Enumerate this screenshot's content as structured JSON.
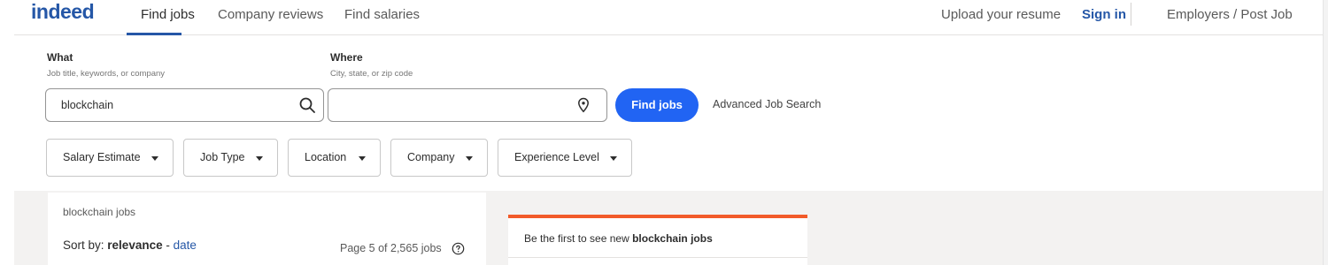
{
  "header": {
    "logo": "indeed",
    "nav": [
      "Find jobs",
      "Company reviews",
      "Find salaries"
    ],
    "upload_resume": "Upload your resume",
    "sign_in": "Sign in",
    "employers": "Employers / Post Job"
  },
  "search": {
    "what_label": "What",
    "what_hint": "Job title, keywords, or company",
    "what_value": "blockchain",
    "where_label": "Where",
    "where_hint": "City, state, or zip code",
    "where_value": "",
    "find_button": "Find jobs",
    "advanced_link": "Advanced Job Search"
  },
  "filters": [
    "Salary Estimate",
    "Job Type",
    "Location",
    "Company",
    "Experience Level"
  ],
  "results": {
    "title": "blockchain jobs",
    "sort_prefix": "Sort by:",
    "sort_active": "relevance",
    "sort_separator": "-",
    "sort_other": "date",
    "page_info": "Page 5 of 2,565 jobs"
  },
  "alert": {
    "text_prefix": "Be the first to see new",
    "text_bold": "blockchain jobs"
  },
  "colors": {
    "brand": "#2557a7",
    "button": "#2164f3",
    "alert_accent": "#f25b2a"
  },
  "icons": [
    "search-icon",
    "location-pin-icon",
    "help-icon",
    "caret-down-icon"
  ]
}
